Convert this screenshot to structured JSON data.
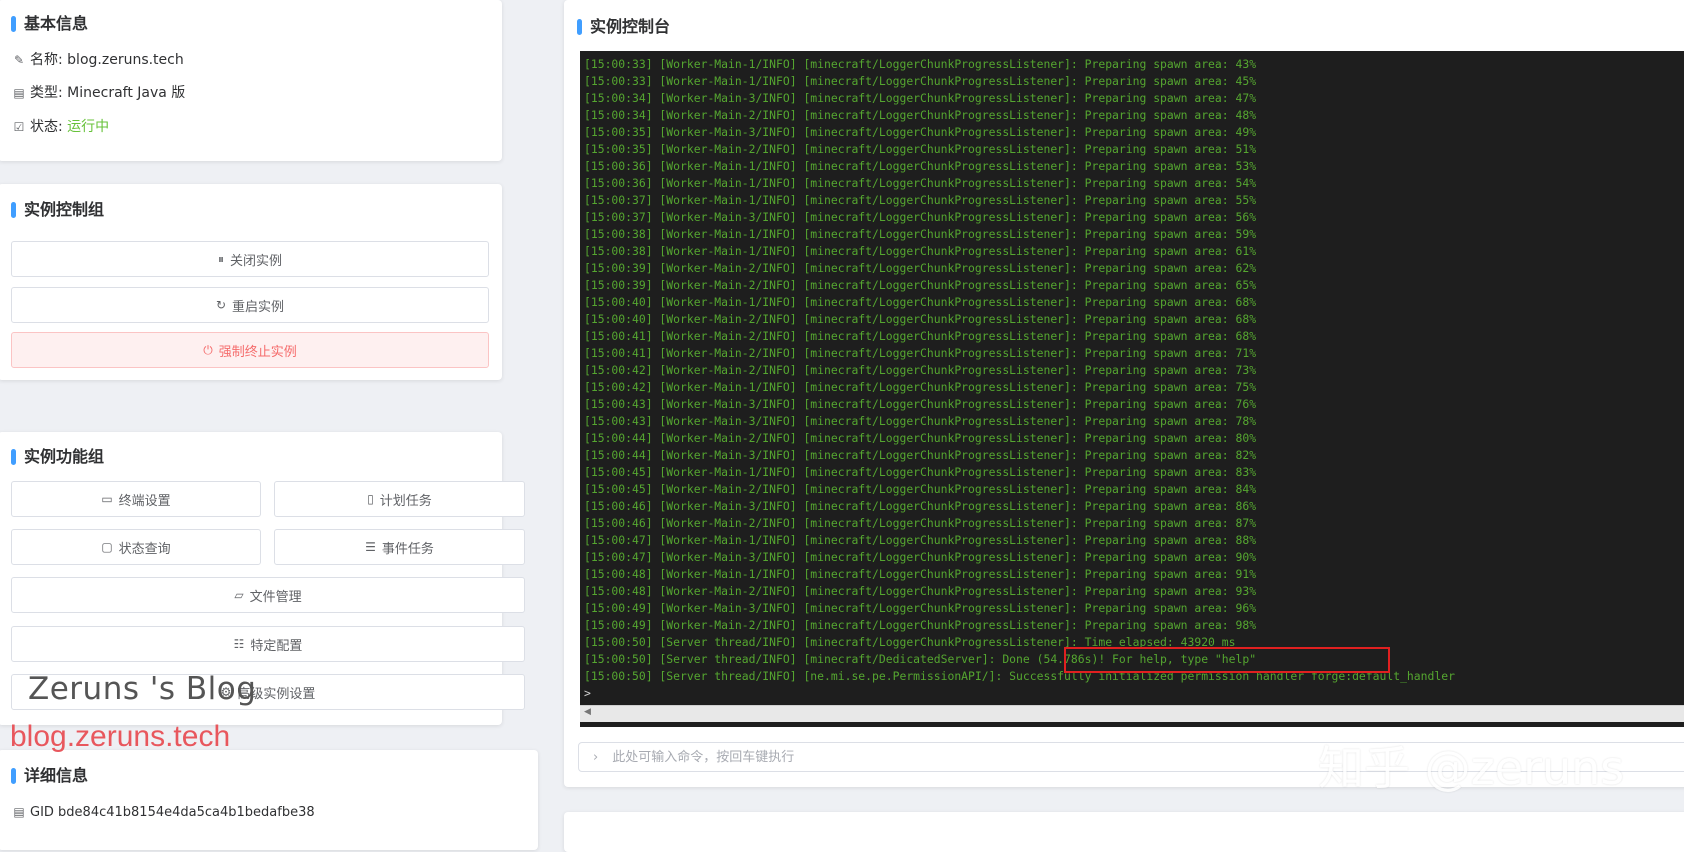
{
  "basic_info": {
    "title": "基本信息",
    "name_label": "名称:",
    "name_value": "blog.zeruns.tech",
    "type_label": "类型:",
    "type_value": "Minecraft Java 版",
    "status_label": "状态:",
    "status_value": "运行中",
    "status_color": "#67c23a"
  },
  "control_group": {
    "title": "实例控制组",
    "close_label": "关闭实例",
    "restart_label": "重启实例",
    "kill_label": "强制终止实例"
  },
  "function_group": {
    "title": "实例功能组",
    "terminal_settings": "终端设置",
    "scheduled_tasks": "计划任务",
    "status_query": "状态查询",
    "event_tasks": "事件任务",
    "file_manager": "文件管理",
    "specific_config": "特定配置",
    "advanced_settings": "高级实例设置"
  },
  "details": {
    "title": "详细信息",
    "gid": "GID bde84c41b8154e4da5ca4b1bedafbe38"
  },
  "console": {
    "title": "实例控制台",
    "lines": [
      "[15:00:33] [Worker-Main-1/INFO] [minecraft/LoggerChunkProgressListener]: Preparing spawn area: 43%",
      "[15:00:33] [Worker-Main-1/INFO] [minecraft/LoggerChunkProgressListener]: Preparing spawn area: 45%",
      "[15:00:34] [Worker-Main-3/INFO] [minecraft/LoggerChunkProgressListener]: Preparing spawn area: 47%",
      "[15:00:34] [Worker-Main-2/INFO] [minecraft/LoggerChunkProgressListener]: Preparing spawn area: 48%",
      "[15:00:35] [Worker-Main-3/INFO] [minecraft/LoggerChunkProgressListener]: Preparing spawn area: 49%",
      "[15:00:35] [Worker-Main-2/INFO] [minecraft/LoggerChunkProgressListener]: Preparing spawn area: 51%",
      "[15:00:36] [Worker-Main-1/INFO] [minecraft/LoggerChunkProgressListener]: Preparing spawn area: 53%",
      "[15:00:36] [Worker-Main-1/INFO] [minecraft/LoggerChunkProgressListener]: Preparing spawn area: 54%",
      "[15:00:37] [Worker-Main-1/INFO] [minecraft/LoggerChunkProgressListener]: Preparing spawn area: 55%",
      "[15:00:37] [Worker-Main-3/INFO] [minecraft/LoggerChunkProgressListener]: Preparing spawn area: 56%",
      "[15:00:38] [Worker-Main-1/INFO] [minecraft/LoggerChunkProgressListener]: Preparing spawn area: 59%",
      "[15:00:38] [Worker-Main-1/INFO] [minecraft/LoggerChunkProgressListener]: Preparing spawn area: 61%",
      "[15:00:39] [Worker-Main-2/INFO] [minecraft/LoggerChunkProgressListener]: Preparing spawn area: 62%",
      "[15:00:39] [Worker-Main-2/INFO] [minecraft/LoggerChunkProgressListener]: Preparing spawn area: 65%",
      "[15:00:40] [Worker-Main-1/INFO] [minecraft/LoggerChunkProgressListener]: Preparing spawn area: 68%",
      "[15:00:40] [Worker-Main-2/INFO] [minecraft/LoggerChunkProgressListener]: Preparing spawn area: 68%",
      "[15:00:41] [Worker-Main-2/INFO] [minecraft/LoggerChunkProgressListener]: Preparing spawn area: 68%",
      "[15:00:41] [Worker-Main-2/INFO] [minecraft/LoggerChunkProgressListener]: Preparing spawn area: 71%",
      "[15:00:42] [Worker-Main-2/INFO] [minecraft/LoggerChunkProgressListener]: Preparing spawn area: 73%",
      "[15:00:42] [Worker-Main-1/INFO] [minecraft/LoggerChunkProgressListener]: Preparing spawn area: 75%",
      "[15:00:43] [Worker-Main-3/INFO] [minecraft/LoggerChunkProgressListener]: Preparing spawn area: 76%",
      "[15:00:43] [Worker-Main-3/INFO] [minecraft/LoggerChunkProgressListener]: Preparing spawn area: 78%",
      "[15:00:44] [Worker-Main-2/INFO] [minecraft/LoggerChunkProgressListener]: Preparing spawn area: 80%",
      "[15:00:44] [Worker-Main-3/INFO] [minecraft/LoggerChunkProgressListener]: Preparing spawn area: 82%",
      "[15:00:45] [Worker-Main-1/INFO] [minecraft/LoggerChunkProgressListener]: Preparing spawn area: 83%",
      "[15:00:45] [Worker-Main-2/INFO] [minecraft/LoggerChunkProgressListener]: Preparing spawn area: 84%",
      "[15:00:46] [Worker-Main-3/INFO] [minecraft/LoggerChunkProgressListener]: Preparing spawn area: 86%",
      "[15:00:46] [Worker-Main-2/INFO] [minecraft/LoggerChunkProgressListener]: Preparing spawn area: 87%",
      "[15:00:47] [Worker-Main-1/INFO] [minecraft/LoggerChunkProgressListener]: Preparing spawn area: 88%",
      "[15:00:47] [Worker-Main-3/INFO] [minecraft/LoggerChunkProgressListener]: Preparing spawn area: 90%",
      "[15:00:48] [Worker-Main-1/INFO] [minecraft/LoggerChunkProgressListener]: Preparing spawn area: 91%",
      "[15:00:48] [Worker-Main-2/INFO] [minecraft/LoggerChunkProgressListener]: Preparing spawn area: 93%",
      "[15:00:49] [Worker-Main-3/INFO] [minecraft/LoggerChunkProgressListener]: Preparing spawn area: 96%",
      "[15:00:49] [Worker-Main-2/INFO] [minecraft/LoggerChunkProgressListener]: Preparing spawn area: 98%",
      "[15:00:50] [Server thread/INFO] [minecraft/LoggerChunkProgressListener]: Time elapsed: 43920 ms",
      "[15:00:50] [Server thread/INFO] [minecraft/DedicatedServer]: Done (54.786s)! For help, type \"help\"",
      "[15:00:50] [Server thread/INFO] [ne.mi.se.pe.PermissionAPI/]: Successfully initialized permission handler forge:default_handler",
      ">"
    ],
    "input_placeholder": "此处可输入命令，按回车键执行"
  },
  "watermarks": {
    "blog_name": "Zeruns 's Blog",
    "blog_url": "blog.zeruns.tech",
    "zhihu": "知乎 @zeruns"
  },
  "colors": {
    "accent": "#409eff",
    "log_green": "#55a630",
    "danger": "#f56c6c",
    "highlight_box": "#e02020"
  },
  "icons": {
    "name": "pencil-icon",
    "type": "document-icon",
    "status": "checklist-icon",
    "close": "pause-circle-icon",
    "restart": "refresh-icon",
    "kill": "power-icon",
    "terminal": "monitor-icon",
    "schedule": "phone-icon",
    "status_query": "chat-icon",
    "event": "list-icon",
    "file": "folder-icon",
    "config": "sliders-icon",
    "advanced": "gear-icon",
    "input": "chevron-right-icon",
    "gid": "file-icon"
  }
}
